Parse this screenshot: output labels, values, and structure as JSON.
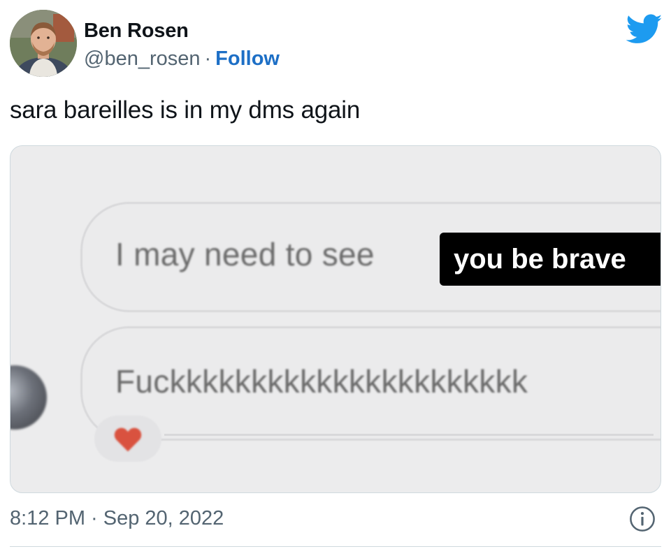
{
  "author": {
    "name": "Ben Rosen",
    "handle": "@ben_rosen",
    "separator": "·",
    "follow_label": "Follow"
  },
  "tweet": {
    "text": "sara bareilles is in my dms again"
  },
  "media": {
    "message_1": "I may need to see",
    "caption": "you be brave",
    "message_2": "Fuckkkkkkkkkkkkkkkkkkkkkk",
    "reaction_icon": "heart-icon"
  },
  "footer": {
    "timestamp": "8:12 PM · Sep 20, 2022",
    "info_icon": "info-icon"
  },
  "colors": {
    "link": "#1d6fc6",
    "twitter_blue": "#1d9bf0",
    "muted_text": "#536471",
    "caption_bg": "#000000",
    "heart": "#d9523f"
  },
  "icons": {
    "brand": "twitter-bird-icon"
  }
}
